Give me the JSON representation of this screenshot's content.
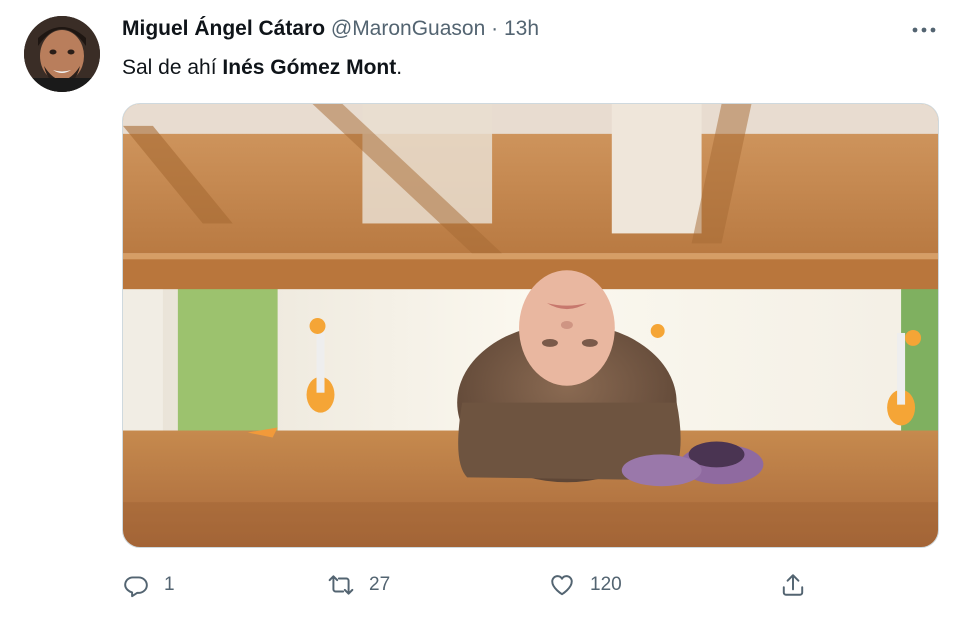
{
  "tweet": {
    "author_name": "Miguel Ángel Cátaro",
    "handle": "@MaronGuason",
    "separator": "·",
    "time": "13h",
    "text_plain": "Sal de ahí ",
    "text_bold": "Inés Gómez Mont",
    "text_end": ".",
    "media_icon": "photo-girl-under-bed"
  },
  "actions": {
    "reply_count": "1",
    "retweet_count": "27",
    "like_count": "120"
  },
  "colors": {
    "text_primary": "#0f1419",
    "text_secondary": "#536471",
    "border": "#cfd9de"
  }
}
